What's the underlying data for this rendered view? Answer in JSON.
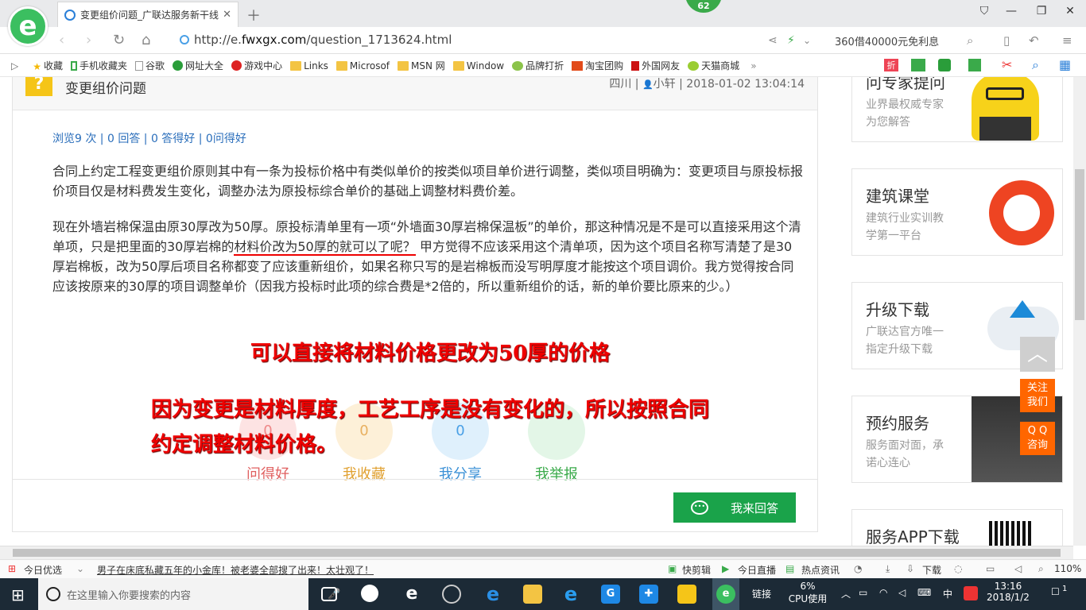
{
  "browser": {
    "tab_title": "变更组价问题_广联达服务新干线",
    "badge_count": "62",
    "url_prefix": "http://e.",
    "url_domain": "fwxgx.com",
    "url_path": "/question_1713624.html",
    "search_hint": "360借40000元免利息"
  },
  "bookmarks": [
    "收藏",
    "手机收藏夹",
    "谷歌",
    "网址大全",
    "游戏中心",
    "Links",
    "Microsof",
    "MSN 网",
    "Window",
    "品牌打折",
    "淘宝团购",
    "外国网友",
    "天猫商城"
  ],
  "question": {
    "title": "变更组价问题",
    "location": "四川",
    "author": "小轩",
    "datetime": "2018-01-02 13:04:14",
    "stats": "浏览9 次 | 0 回答 | 0 答得好 | 0问得好",
    "para1": "合同上约定工程变更组价原则其中有一条为投标价格中有类似单价的按类似项目单价进行调整，类似项目明确为：变更项目与原投标报价项目仅是材料费发生变化，调整办法为原投标综合单价的基础上调整材料费价差。",
    "para2_a": "现在外墙岩棉保温由原30厚改为50厚。原投标清单里有一项“外墙面30厚岩棉保温板”的单价，那这种情况是不是可以直接采用这个清单项，只是把里面的30厚岩棉的",
    "para2_u": "材料价改为50厚的就可以了呢？",
    "para2_b": "  甲方觉得不应该采用这个清单项，因为这个项目名称写清楚了是30厚岩棉板，改为50厚后项目名称都变了应该重新组价，如果名称只写的是岩棉板而没写明厚度才能按这个项目调价。我方觉得按合同应该按原来的30厚的项目调整单价（因我方投标时此项的综合费是*2倍的，所以重新组价的话，新的单价要比原来的少。）"
  },
  "actions": [
    {
      "count": "0",
      "label": "问得好"
    },
    {
      "count": "0",
      "label": "我收藏"
    },
    {
      "count": "0",
      "label": "我分享"
    },
    {
      "count": "",
      "label": "我举报"
    }
  ],
  "overlay": {
    "line1": "可以直接将材料价格更改为50厚的价格",
    "line2": "因为变更是材料厚度，工艺工序是没有变化的，所以按照合同",
    "line3": "约定调整材料价格。"
  },
  "answer_button": "我来回答",
  "sidebar": [
    {
      "title": "问专家提问",
      "sub1": "业界最权威专家",
      "sub2": "为您解答"
    },
    {
      "title": "建筑课堂",
      "sub1": "建筑行业实训教",
      "sub2": "学第一平台"
    },
    {
      "title": "升级下载",
      "sub1": "广联达官方唯一",
      "sub2": "指定升级下载"
    },
    {
      "title": "预约服务",
      "sub1": "服务面对面，承",
      "sub2": "诺心连心"
    },
    {
      "title": "服务APP下载",
      "sub1": "",
      "sub2": ""
    }
  ],
  "float": {
    "follow1": "关注",
    "follow2": "我们",
    "qq1": "Q Q",
    "qq2": "咨询"
  },
  "statusbar": {
    "today": "今日优选",
    "news": "男子在床底私藏五年的小金库！被老婆全部搜了出来！太壮观了！",
    "quickcut": "快剪辑",
    "live": "今日直播",
    "hot": "热点资讯",
    "download": "下载",
    "zoom": "110%"
  },
  "taskbar": {
    "search_placeholder": "在这里输入你要搜索的内容",
    "link": "链接",
    "cpu_pct": "6%",
    "cpu_label": "CPU使用",
    "ime": "中",
    "time": "13:16",
    "date": "2018/1/2",
    "notif": "1"
  },
  "colors": {
    "accent_green": "#1aa34a",
    "overlay_red": "#e00000",
    "link_blue": "#2a6ebb",
    "side_orange": "#ff6600"
  }
}
